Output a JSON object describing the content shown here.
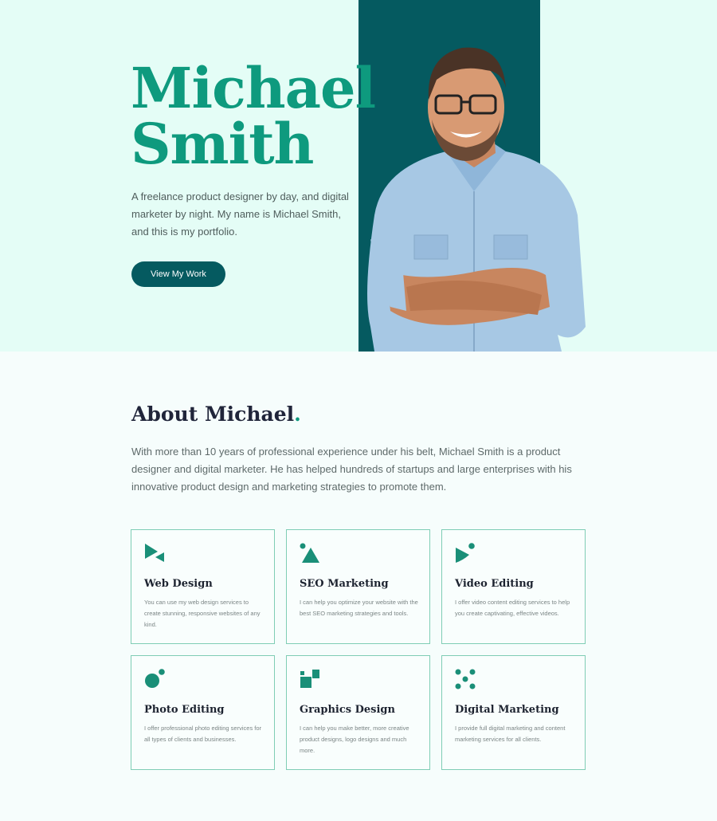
{
  "hero": {
    "name_line1": "Michael",
    "name_line2": "Smith",
    "intro": "A freelance product designer by day, and digital marketer by night. My name is Michael Smith, and this is my portfolio.",
    "cta_label": "View My Work",
    "photo_icon": "man-portrait-crossed-arms"
  },
  "about": {
    "title": "About Michael",
    "title_dot": ".",
    "text": "With more than 10 years of professional experience under his belt, Michael Smith is a product designer and digital marketer. He has helped hundreds of startups and large enterprises with his innovative product design and marketing strategies to promote them."
  },
  "services": [
    {
      "title": "Web Design",
      "desc": "You can use my web design services to create stunning, responsive websites of any kind.",
      "icon": "play-triangles-icon"
    },
    {
      "title": "SEO Marketing",
      "desc": "I can help you optimize your website with the best SEO marketing strategies and tools.",
      "icon": "triangle-dot-icon"
    },
    {
      "title": "Video Editing",
      "desc": "I offer video content editing services to help you create captivating, effective videos.",
      "icon": "play-dot-icon"
    },
    {
      "title": "Photo Editing",
      "desc": "I offer professional photo editing services for all types of clients and businesses.",
      "icon": "circles-icon"
    },
    {
      "title": "Graphics Design",
      "desc": "I can help you make better, more creative product designs, logo designs and much more.",
      "icon": "squares-icon"
    },
    {
      "title": "Digital Marketing",
      "desc": "I provide full digital marketing and content marketing services for all clients.",
      "icon": "dots-grid-icon"
    }
  ],
  "colors": {
    "accent": "#0e9a7e",
    "dark_teal": "#055a60",
    "hero_bg": "#e4fdf6"
  }
}
